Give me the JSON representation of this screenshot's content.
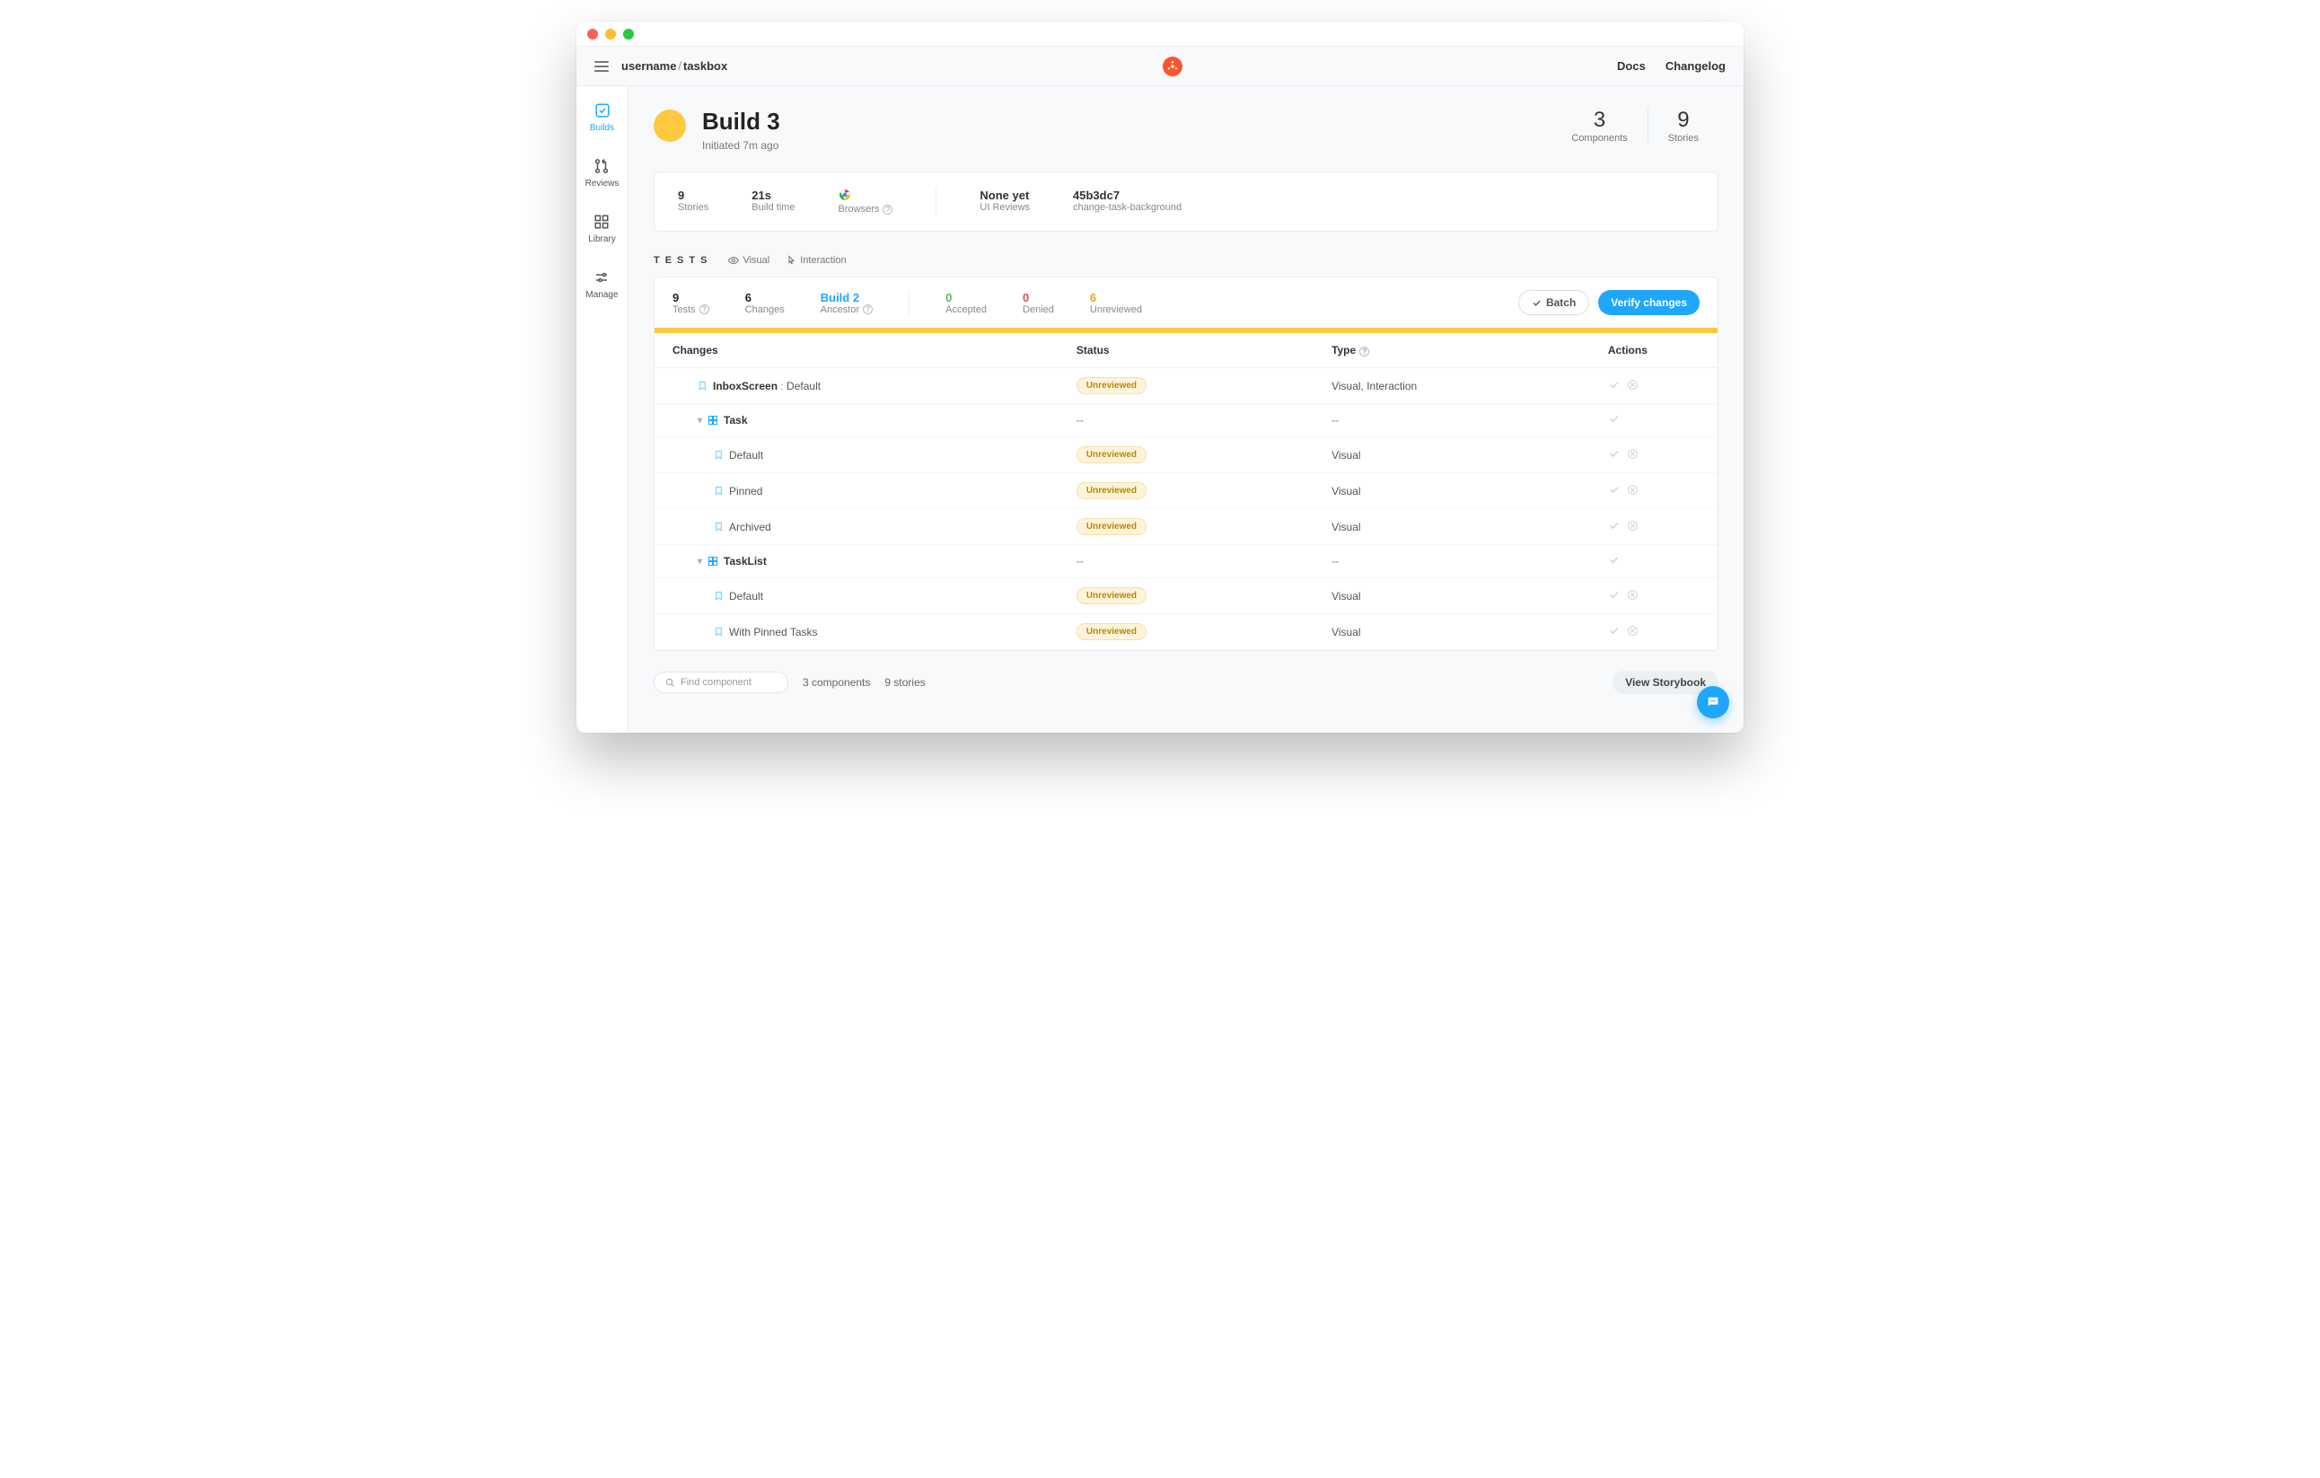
{
  "header": {
    "breadcrumb_user": "username",
    "breadcrumb_repo": "taskbox",
    "docs": "Docs",
    "changelog": "Changelog"
  },
  "sidebar": {
    "builds": "Builds",
    "reviews": "Reviews",
    "library": "Library",
    "manage": "Manage"
  },
  "hero": {
    "title": "Build 3",
    "subtitle": "Initiated 7m ago",
    "components_num": "3",
    "components_lbl": "Components",
    "stories_num": "9",
    "stories_lbl": "Stories"
  },
  "summary": {
    "stories_v": "9",
    "stories_l": "Stories",
    "buildtime_v": "21s",
    "buildtime_l": "Build time",
    "browsers_l": "Browsers",
    "uireviews_v": "None yet",
    "uireviews_l": "UI Reviews",
    "commit_v": "45b3dc7",
    "branch_l": "change-task-background"
  },
  "tests_head": {
    "label": "TESTS",
    "visual": "Visual",
    "interaction": "Interaction"
  },
  "strip": {
    "tests_v": "9",
    "tests_l": "Tests",
    "changes_v": "6",
    "changes_l": "Changes",
    "ancestor_v": "Build 2",
    "ancestor_l": "Ancestor",
    "accepted_v": "0",
    "accepted_l": "Accepted",
    "denied_v": "0",
    "denied_l": "Denied",
    "unreviewed_v": "6",
    "unreviewed_l": "Unreviewed",
    "batch": "Batch",
    "verify": "Verify changes"
  },
  "table": {
    "h_changes": "Changes",
    "h_status": "Status",
    "h_type": "Type",
    "h_actions": "Actions",
    "rows": [
      {
        "kind": "story",
        "indent": 1,
        "prefix": "InboxScreen",
        "name": "Default",
        "status": "Unreviewed",
        "type": "Visual, Interaction"
      },
      {
        "kind": "group",
        "indent": 0,
        "name": "Task",
        "status": "--",
        "type": "--"
      },
      {
        "kind": "story",
        "indent": 2,
        "name": "Default",
        "status": "Unreviewed",
        "type": "Visual"
      },
      {
        "kind": "story",
        "indent": 2,
        "name": "Pinned",
        "status": "Unreviewed",
        "type": "Visual"
      },
      {
        "kind": "story",
        "indent": 2,
        "name": "Archived",
        "status": "Unreviewed",
        "type": "Visual"
      },
      {
        "kind": "group",
        "indent": 0,
        "name": "TaskList",
        "status": "--",
        "type": "--"
      },
      {
        "kind": "story",
        "indent": 2,
        "name": "Default",
        "status": "Unreviewed",
        "type": "Visual"
      },
      {
        "kind": "story",
        "indent": 2,
        "name": "With Pinned Tasks",
        "status": "Unreviewed",
        "type": "Visual"
      }
    ]
  },
  "footer": {
    "search_placeholder": "Find component",
    "components": "3 components",
    "stories": "9 stories",
    "view_storybook": "View Storybook"
  }
}
